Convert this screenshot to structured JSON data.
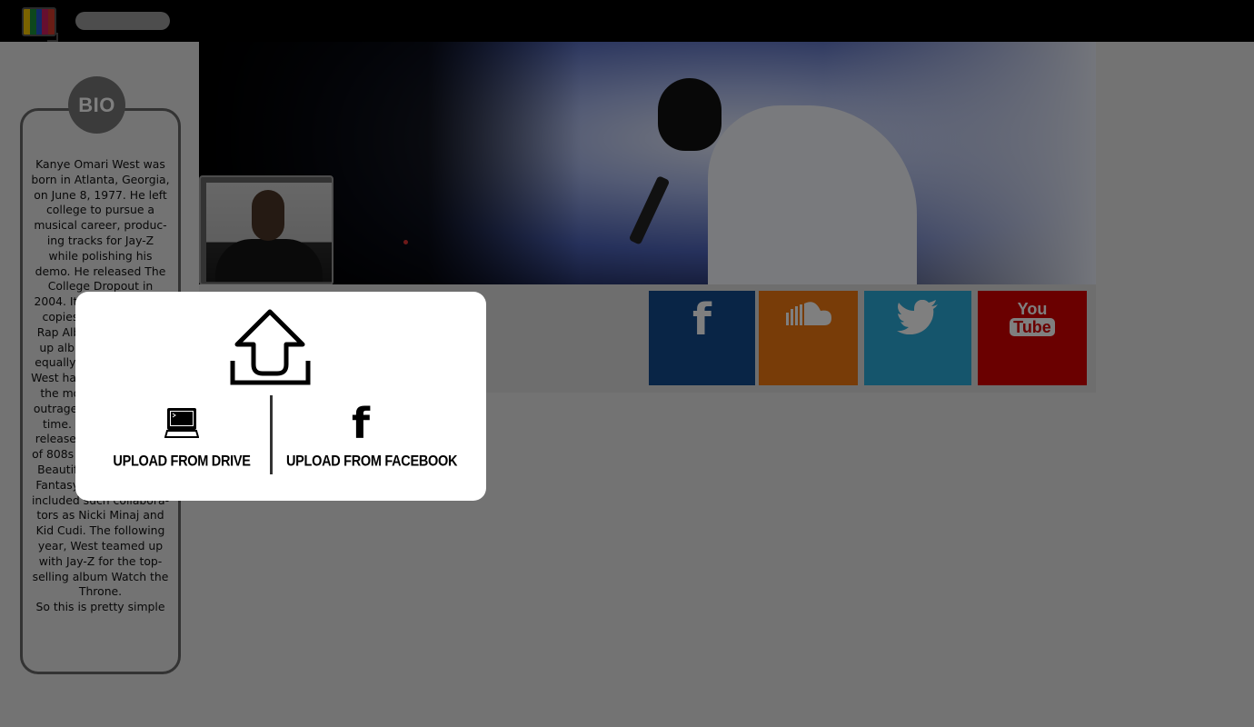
{
  "topbar": {
    "logo_icon": "tv-logo-icon",
    "logo_colors": [
      "#f5c400",
      "#1a8f3a",
      "#2255cc",
      "#cc1f5f",
      "#d23a2a"
    ],
    "search_placeholder": ""
  },
  "profile": {
    "cover_image": "concert-cover-image",
    "avatar_image": "artist-avatar-image"
  },
  "bio": {
    "badge": "BIO",
    "text": "Kanye Omari West was born in Atlanta, Georgia, on June 8, 1977. He left college to pursue a musical career, produc-ing tracks for Jay-Z while polishing his demo. He released The College Dropout in 2004. It sold 2.6 million copies and won Best Rap Album. His follow-up albums have been equally successful, and West has become one of the most famous and outrageous artists of all time. After years, he released the new wave of 808s and debuted My Beautiful Dark Twisted Fantasy in 2010, which included such collabora-tors as Nicki Minaj and Kid Cudi. The following year, West teamed up with Jay-Z for the top-selling album Watch the Throne.",
    "extra": "So this is pretty simple"
  },
  "social": {
    "tiles": [
      {
        "name": "facebook",
        "icon": "facebook-icon",
        "glyph": "f",
        "color": "#124a8c"
      },
      {
        "name": "soundcloud",
        "icon": "soundcloud-icon",
        "glyph": "☁",
        "color": "#f07810"
      },
      {
        "name": "twitter",
        "icon": "twitter-icon",
        "glyph": "🐦",
        "color": "#2aaad8"
      },
      {
        "name": "youtube",
        "icon": "youtube-icon",
        "you": "You",
        "tube": "Tube",
        "color": "#d40000"
      }
    ]
  },
  "upload_modal": {
    "icon": "upload-arrow-icon",
    "drive": {
      "icon": "computer-icon",
      "label": "UPLOAD FROM DRIVE"
    },
    "facebook": {
      "icon": "facebook-icon",
      "glyph": "f",
      "label": "UPLOAD FROM FACEBOOK"
    }
  }
}
